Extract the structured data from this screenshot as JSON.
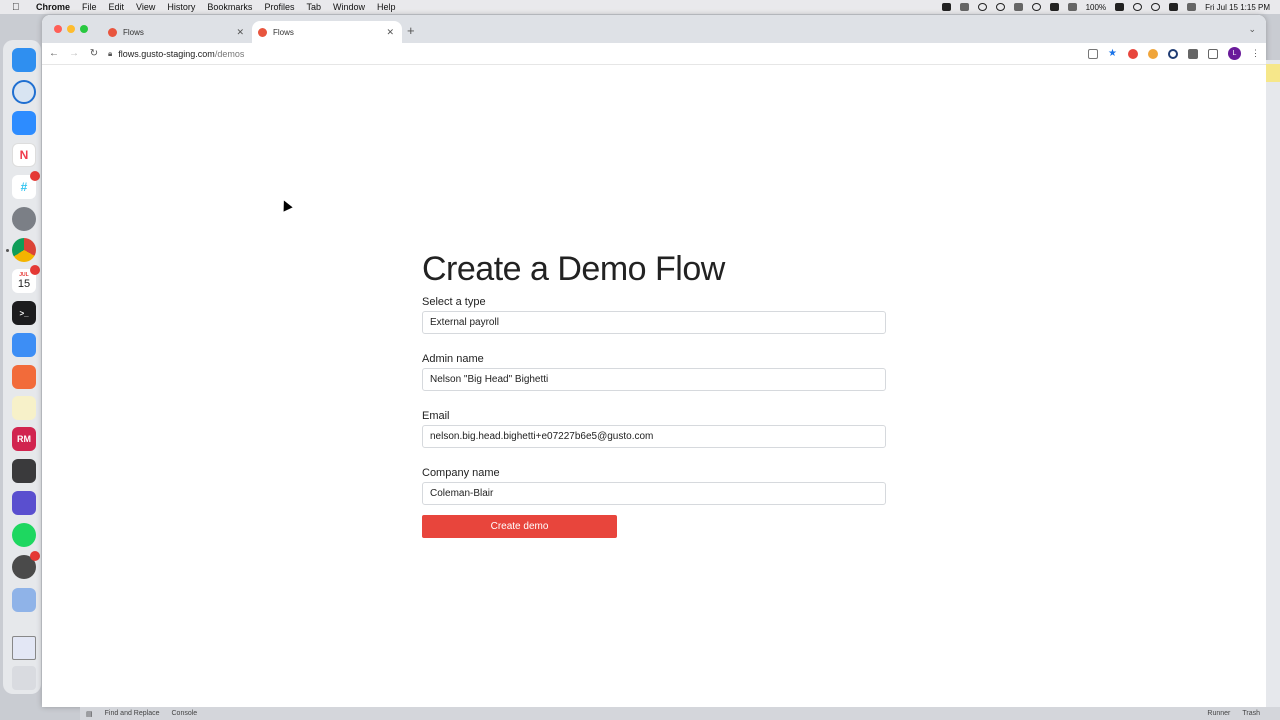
{
  "menubar": {
    "app": "Chrome",
    "items": [
      "File",
      "Edit",
      "View",
      "History",
      "Bookmarks",
      "Profiles",
      "Tab",
      "Window",
      "Help"
    ],
    "battery": "100%",
    "clock": "Fri Jul 15  1:15 PM"
  },
  "dock": {
    "calendar_month": "JUL",
    "calendar_day": "15",
    "rm_label": "RM"
  },
  "browser": {
    "tabs": [
      {
        "title": "Flows",
        "active": false
      },
      {
        "title": "Flows",
        "active": true
      }
    ],
    "new_tab": "+",
    "url_host": "flows.gusto-staging.com",
    "url_path": "/demos",
    "profile_initial": "L"
  },
  "form": {
    "title": "Create a Demo Flow",
    "type_label": "Select a type",
    "type_value": "External payroll",
    "admin_label": "Admin name",
    "admin_value": "Nelson \"Big Head\" Bighetti",
    "email_label": "Email",
    "email_value": "nelson.big.head.bighetti+e07227b6e5@gusto.com",
    "company_label": "Company name",
    "company_value": "Coleman-Blair",
    "submit_label": "Create demo"
  },
  "bottom": {
    "find_replace": "Find and Replace",
    "console": "Console",
    "runner": "Runner",
    "trash": "Trash"
  },
  "colors": {
    "accent": "#e8453c"
  }
}
